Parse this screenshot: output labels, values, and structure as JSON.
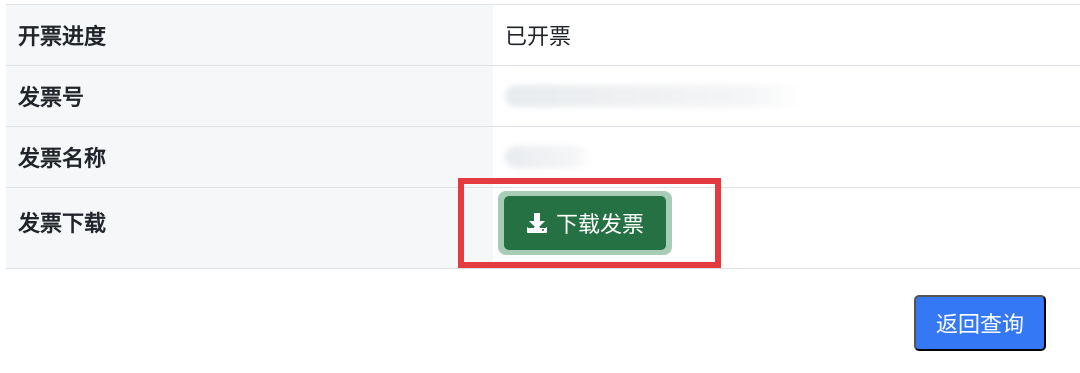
{
  "invoice_table": {
    "rows": [
      {
        "label": "开票进度",
        "value": "已开票"
      },
      {
        "label": "发票号",
        "value": ""
      },
      {
        "label": "发票名称",
        "value": ""
      },
      {
        "label": "发票下载",
        "value": ""
      }
    ]
  },
  "download": {
    "label": "下载发票",
    "icon": "download-icon",
    "color": "#257143"
  },
  "highlight": {
    "color": "#e33b3f"
  },
  "back_button": {
    "label": "返回查询",
    "color": "#3478f6"
  }
}
